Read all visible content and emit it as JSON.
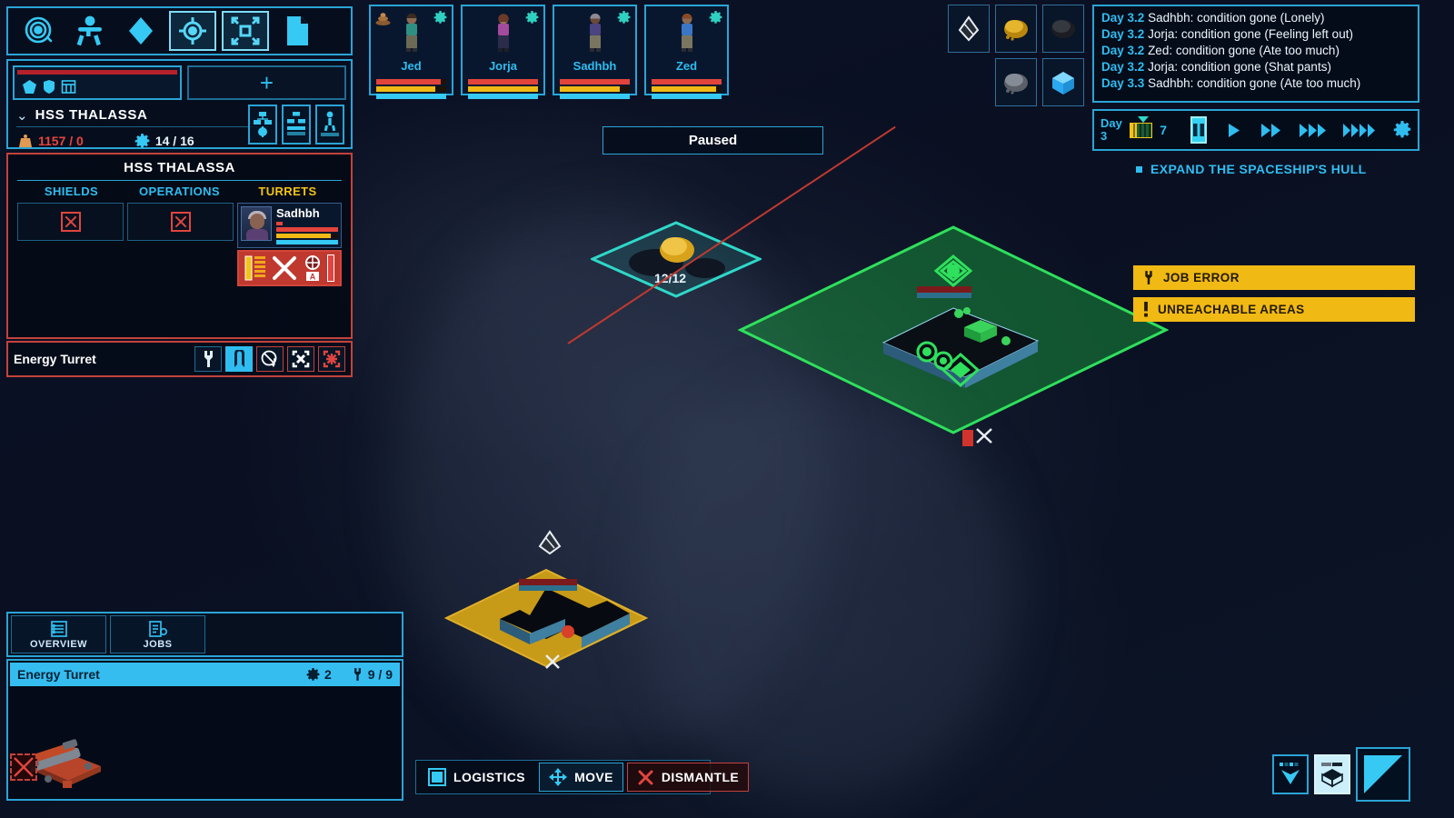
{
  "toolbar": {
    "items": [
      {
        "name": "planet-orbit-icon",
        "label": "Planet"
      },
      {
        "name": "crew-icon",
        "label": "Crew"
      },
      {
        "name": "resource-diamond-icon",
        "label": "Resources"
      },
      {
        "name": "targeting-icon",
        "label": "Targeting"
      },
      {
        "name": "expand-icon",
        "label": "Expand"
      },
      {
        "name": "document-icon",
        "label": "Reports"
      }
    ]
  },
  "ship_header": {
    "tab_icons": [
      "hull-icon",
      "shield-icon",
      "grid-icon"
    ],
    "add_label": "+",
    "chevron": "⌄",
    "name": "HSS THALASSA",
    "mass_value": "1157 / 0",
    "power_value": "14 / 16",
    "side_icons": [
      "logistics-network-icon",
      "storage-icon",
      "crew-assign-icon"
    ]
  },
  "ship_detail": {
    "title": "HSS THALASSA",
    "categories": [
      {
        "label": "SHIELDS",
        "color": "cyan",
        "state": "empty"
      },
      {
        "label": "OPERATIONS",
        "color": "cyan",
        "state": "empty"
      },
      {
        "label": "TURRETS",
        "color": "amber",
        "state": "assigned"
      }
    ],
    "assigned_crew": {
      "name": "Sadhbh",
      "bars": [
        {
          "name": "health",
          "color": "#e2443c",
          "pct": 100
        },
        {
          "name": "stamina",
          "color": "#f0b914",
          "pct": 88
        },
        {
          "name": "mood",
          "color": "#35c9f4",
          "pct": 100
        }
      ]
    },
    "turret_action_icons": [
      "ammo-bars-icon",
      "crossed-weapons-icon",
      "auto-target-icon"
    ]
  },
  "turret_bar": {
    "label": "Energy Turret",
    "buttons": [
      {
        "name": "repair-button",
        "icon": "wrench-icon",
        "state": "normal"
      },
      {
        "name": "auto-mode-button",
        "icon": "letter-a-icon",
        "state": "selected"
      },
      {
        "name": "power-cycle-button",
        "icon": "power-reset-icon",
        "state": "danger"
      },
      {
        "name": "deactivate-button",
        "icon": "x-icon",
        "state": "danger"
      },
      {
        "name": "dismantle-button",
        "icon": "dismantle-icon",
        "state": "danger2"
      }
    ]
  },
  "crew": [
    {
      "name": "Jed",
      "mood_icon": "poop-icon",
      "gear_icon": "gear-icon",
      "shirt": "#2f8f82",
      "pants": "#6b6a55",
      "hair": "#3a2a20",
      "bars": [
        {
          "color": "#e2443c",
          "pct": 92
        },
        {
          "color": "#f0b914",
          "pct": 84
        },
        {
          "color": "#35c9f4",
          "pct": 100
        }
      ]
    },
    {
      "name": "Jorja",
      "mood_icon": "",
      "gear_icon": "gear-icon",
      "shirt": "#a34b9c",
      "pants": "#2b2b4a",
      "hair": "#6b3a28",
      "bars": [
        {
          "color": "#e2443c",
          "pct": 100
        },
        {
          "color": "#f0b914",
          "pct": 100
        },
        {
          "color": "#35c9f4",
          "pct": 100
        }
      ]
    },
    {
      "name": "Sadhbh",
      "mood_icon": "",
      "gear_icon": "gear-icon",
      "shirt": "#4a4480",
      "pants": "#7a7560",
      "hair": "#8d8a93",
      "bars": [
        {
          "color": "#e2443c",
          "pct": 100
        },
        {
          "color": "#f0b914",
          "pct": 86
        },
        {
          "color": "#35c9f4",
          "pct": 100
        }
      ]
    },
    {
      "name": "Zed",
      "mood_icon": "",
      "gear_icon": "gear-icon",
      "shirt": "#3a76c4",
      "pants": "#7a7560",
      "hair": "#8a4a26",
      "bars": [
        {
          "color": "#e2443c",
          "pct": 100
        },
        {
          "color": "#f0b914",
          "pct": 92
        },
        {
          "color": "#35c9f4",
          "pct": 100
        }
      ]
    }
  ],
  "paused_label": "Paused",
  "resources": [
    {
      "name": "scrap-resource",
      "kind": "scrap"
    },
    {
      "name": "gold-ore-resource",
      "kind": "gold"
    },
    {
      "name": "dark-ore-resource",
      "kind": "dark"
    },
    {
      "name": "stone-ore-resource",
      "kind": "stone"
    },
    {
      "name": "ice-crystal-resource",
      "kind": "ice"
    }
  ],
  "log": [
    {
      "day": "Day 3.2",
      "text": "Sadhbh: condition gone (Lonely)"
    },
    {
      "day": "Day 3.2",
      "text": "Jorja: condition gone (Feeling left out)"
    },
    {
      "day": "Day 3.2",
      "text": "Zed: condition gone (Ate too much)"
    },
    {
      "day": "Day 3.2",
      "text": "Jorja: condition gone (Shat pants)"
    },
    {
      "day": "Day 3.3",
      "text": "Sadhbh: condition gone (Ate too much)"
    }
  ],
  "time": {
    "day_word": "Day",
    "day_number": "3",
    "counter": "7",
    "meter_pct": 34,
    "speeds": [
      {
        "name": "pause-button",
        "icon": "pause-icon",
        "active": true
      },
      {
        "name": "play-button",
        "icon": "play-icon",
        "active": false
      },
      {
        "name": "fast-forward-2x-button",
        "icon": "ff2-icon",
        "active": false
      },
      {
        "name": "fast-forward-3x-button",
        "icon": "ff3-icon",
        "active": false
      },
      {
        "name": "fast-forward-4x-button",
        "icon": "ff4-icon",
        "active": false
      }
    ],
    "settings_icon": "gear-icon"
  },
  "objective": {
    "text": "EXPAND THE SPACESHIP'S HULL"
  },
  "alerts": [
    {
      "name": "job-error-alert",
      "icon": "wrench-icon",
      "text": "JOB ERROR"
    },
    {
      "name": "unreachable-areas-alert",
      "icon": "exclamation-icon",
      "text": "UNREACHABLE AREAS"
    }
  ],
  "build_panel": {
    "tabs": [
      {
        "name": "tab-overview",
        "label": "OVERVIEW",
        "icon": "list-icon"
      },
      {
        "name": "tab-jobs",
        "label": "JOBS",
        "icon": "clipboard-gear-icon"
      }
    ],
    "selected_item": {
      "name": "Energy Turret",
      "gear_count": "2",
      "work_progress": "9 / 9"
    }
  },
  "command_bar": [
    {
      "name": "logistics-button",
      "label": "LOGISTICS",
      "icon": "square-icon",
      "style": "plain"
    },
    {
      "name": "move-button",
      "label": "MOVE",
      "icon": "move-arrows-icon",
      "style": "cyan"
    },
    {
      "name": "dismantle-button",
      "label": "DISMANTLE",
      "icon": "x-icon",
      "style": "red"
    }
  ],
  "view_buttons": [
    {
      "name": "roof-view-button",
      "icon": "open-box-icon",
      "active": false
    },
    {
      "name": "solid-view-button",
      "icon": "closed-box-icon",
      "active": true
    }
  ],
  "minimap": {
    "name": "minimap"
  },
  "world": {
    "ore_node_label": "12/12",
    "colors": {
      "selection_green": "#2fe05c",
      "hover_gold": "#d4a21a",
      "zone_cyan": "#2fd8c8",
      "beam_red": "#c0392f"
    }
  }
}
